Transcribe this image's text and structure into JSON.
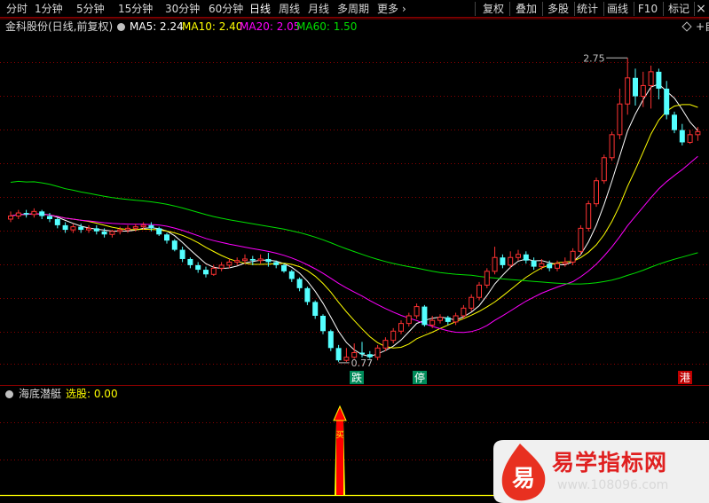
{
  "toolbar": {
    "periods": [
      "分时",
      "1分钟",
      "5分钟",
      "15分钟",
      "30分钟",
      "60分钟",
      "日线",
      "周线",
      "月线",
      "多周期",
      "更多"
    ],
    "active_period": "日线",
    "more_chevron": "›",
    "right_buttons": [
      "复权",
      "叠加",
      "多股",
      "统计",
      "画线",
      "F10",
      "标记"
    ],
    "close_glyph": "×",
    "min_glyph": "−"
  },
  "legend": {
    "stock_name": "金科股份(日线,前复权)",
    "ma5": "MA5: 2.24",
    "ma10": "MA10: 2.40",
    "ma20": "MA20: 2.05",
    "ma60": "MA60: 1.50",
    "right_text": "+自"
  },
  "annotations": {
    "high_label": "2.75",
    "low_label": "0.77",
    "mark_die": "跌",
    "mark_ting": "停",
    "mark_gang": "港"
  },
  "indicator": {
    "name": "海底潜艇",
    "select_label": "选股: 0.00",
    "signal_glyph": "买"
  },
  "watermark": {
    "logo_char": "易",
    "title": "易学指标网",
    "url": "www.108096.com"
  },
  "colors": {
    "up": "#ff3232",
    "down": "#54ffff",
    "ma5": "#ffffff",
    "ma10": "#ffff00",
    "ma20": "#ff00ff",
    "ma60": "#00e000",
    "grid": "#8b0000",
    "signal": "#ff0000"
  },
  "chart_data": {
    "type": "candlestick",
    "price_range": [
      0.7,
      2.85
    ],
    "high": 2.75,
    "low": 0.77,
    "candles": [
      [
        1.7,
        1.72,
        1.75,
        1.68
      ],
      [
        1.72,
        1.74,
        1.76,
        1.7
      ],
      [
        1.74,
        1.73,
        1.76,
        1.71
      ],
      [
        1.73,
        1.75,
        1.77,
        1.71
      ],
      [
        1.75,
        1.72,
        1.76,
        1.7
      ],
      [
        1.72,
        1.7,
        1.74,
        1.68
      ],
      [
        1.7,
        1.66,
        1.71,
        1.64
      ],
      [
        1.66,
        1.63,
        1.68,
        1.61
      ],
      [
        1.63,
        1.65,
        1.67,
        1.61
      ],
      [
        1.65,
        1.63,
        1.67,
        1.61
      ],
      [
        1.63,
        1.64,
        1.66,
        1.61
      ],
      [
        1.64,
        1.62,
        1.66,
        1.6
      ],
      [
        1.62,
        1.6,
        1.64,
        1.58
      ],
      [
        1.6,
        1.62,
        1.63,
        1.58
      ],
      [
        1.62,
        1.63,
        1.65,
        1.6
      ],
      [
        1.63,
        1.64,
        1.66,
        1.61
      ],
      [
        1.64,
        1.65,
        1.67,
        1.62
      ],
      [
        1.65,
        1.66,
        1.68,
        1.63
      ],
      [
        1.66,
        1.64,
        1.68,
        1.62
      ],
      [
        1.64,
        1.6,
        1.65,
        1.59
      ],
      [
        1.6,
        1.56,
        1.61,
        1.54
      ],
      [
        1.56,
        1.5,
        1.57,
        1.49
      ],
      [
        1.5,
        1.44,
        1.52,
        1.42
      ],
      [
        1.44,
        1.4,
        1.45,
        1.38
      ],
      [
        1.4,
        1.37,
        1.42,
        1.35
      ],
      [
        1.37,
        1.34,
        1.39,
        1.32
      ],
      [
        1.34,
        1.38,
        1.4,
        1.33
      ],
      [
        1.38,
        1.4,
        1.42,
        1.36
      ],
      [
        1.4,
        1.42,
        1.44,
        1.38
      ],
      [
        1.42,
        1.43,
        1.45,
        1.4
      ],
      [
        1.43,
        1.44,
        1.47,
        1.41
      ],
      [
        1.44,
        1.43,
        1.46,
        1.4
      ],
      [
        1.43,
        1.44,
        1.47,
        1.41
      ],
      [
        1.44,
        1.42,
        1.48,
        1.39
      ],
      [
        1.42,
        1.4,
        1.43,
        1.38
      ],
      [
        1.4,
        1.36,
        1.41,
        1.35
      ],
      [
        1.36,
        1.31,
        1.37,
        1.29
      ],
      [
        1.31,
        1.25,
        1.32,
        1.23
      ],
      [
        1.25,
        1.16,
        1.26,
        1.14
      ],
      [
        1.16,
        1.07,
        1.17,
        1.05
      ],
      [
        1.07,
        0.97,
        1.08,
        0.95
      ],
      [
        0.97,
        0.86,
        0.98,
        0.84
      ],
      [
        0.86,
        0.78,
        0.88,
        0.77
      ],
      [
        0.78,
        0.8,
        0.86,
        0.77
      ],
      [
        0.8,
        0.83,
        0.89,
        0.79
      ],
      [
        0.83,
        0.82,
        0.9,
        0.8
      ],
      [
        0.82,
        0.8,
        0.84,
        0.79
      ],
      [
        0.8,
        0.86,
        0.88,
        0.78
      ],
      [
        0.86,
        0.91,
        0.93,
        0.84
      ],
      [
        0.91,
        0.97,
        0.99,
        0.89
      ],
      [
        0.97,
        1.02,
        1.04,
        0.95
      ],
      [
        1.02,
        1.07,
        1.09,
        1.0
      ],
      [
        1.07,
        1.13,
        1.15,
        1.05
      ],
      [
        1.13,
        1.01,
        1.14,
        1.0
      ],
      [
        1.01,
        1.04,
        1.07,
        0.99
      ],
      [
        1.04,
        1.06,
        1.08,
        1.02
      ],
      [
        1.06,
        1.03,
        1.07,
        1.01
      ],
      [
        1.03,
        1.07,
        1.09,
        1.01
      ],
      [
        1.07,
        1.12,
        1.14,
        1.05
      ],
      [
        1.12,
        1.19,
        1.21,
        1.1
      ],
      [
        1.19,
        1.27,
        1.29,
        1.17
      ],
      [
        1.27,
        1.36,
        1.38,
        1.25
      ],
      [
        1.36,
        1.45,
        1.52,
        1.34
      ],
      [
        1.45,
        1.4,
        1.47,
        1.38
      ],
      [
        1.4,
        1.45,
        1.49,
        1.38
      ],
      [
        1.45,
        1.47,
        1.5,
        1.43
      ],
      [
        1.47,
        1.43,
        1.49,
        1.41
      ],
      [
        1.43,
        1.39,
        1.45,
        1.37
      ],
      [
        1.39,
        1.41,
        1.44,
        1.37
      ],
      [
        1.41,
        1.38,
        1.43,
        1.36
      ],
      [
        1.38,
        1.41,
        1.43,
        1.36
      ],
      [
        1.41,
        1.42,
        1.45,
        1.39
      ],
      [
        1.42,
        1.49,
        1.51,
        1.4
      ],
      [
        1.49,
        1.64,
        1.66,
        1.47
      ],
      [
        1.64,
        1.8,
        1.82,
        1.62
      ],
      [
        1.8,
        1.95,
        1.97,
        1.78
      ],
      [
        1.95,
        2.1,
        2.12,
        1.93
      ],
      [
        2.1,
        2.25,
        2.27,
        2.08
      ],
      [
        2.25,
        2.45,
        2.55,
        2.22
      ],
      [
        2.45,
        2.62,
        2.75,
        2.38
      ],
      [
        2.62,
        2.5,
        2.68,
        2.44
      ],
      [
        2.5,
        2.57,
        2.66,
        2.43
      ],
      [
        2.57,
        2.66,
        2.7,
        2.42
      ],
      [
        2.66,
        2.55,
        2.68,
        2.48
      ],
      [
        2.55,
        2.38,
        2.6,
        2.35
      ],
      [
        2.38,
        2.28,
        2.4,
        2.26
      ],
      [
        2.28,
        2.2,
        2.32,
        2.18
      ],
      [
        2.2,
        2.25,
        2.28,
        2.19
      ],
      [
        2.25,
        2.27,
        2.3,
        2.21
      ]
    ]
  }
}
